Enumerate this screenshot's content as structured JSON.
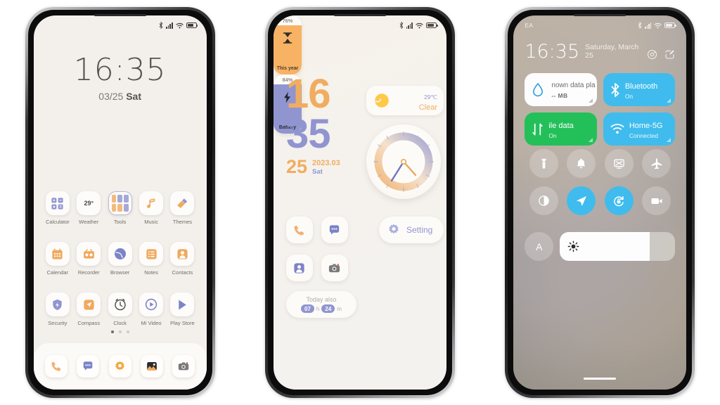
{
  "page": {
    "background": "#ffffff"
  },
  "phone1": {
    "name": "home-screen",
    "statusbar": {
      "icons": [
        "bluetooth-icon",
        "signal-icon",
        "wifi-icon",
        "battery-icon"
      ]
    },
    "clock": {
      "time": "16:35",
      "date_mmdd": "03/25",
      "weekday": "Sat"
    },
    "apps": [
      {
        "label": "Calculator",
        "icon": "calculator-icon"
      },
      {
        "label": "Weather",
        "icon": "weather-icon",
        "badge": "29°"
      },
      {
        "label": "Tools",
        "icon": "folder-icon"
      },
      {
        "label": "Music",
        "icon": "music-icon"
      },
      {
        "label": "Themes",
        "icon": "themes-icon"
      },
      {
        "label": "Calendar",
        "icon": "calendar-icon"
      },
      {
        "label": "Recorder",
        "icon": "recorder-icon"
      },
      {
        "label": "Browser",
        "icon": "browser-icon"
      },
      {
        "label": "Notes",
        "icon": "notes-icon"
      },
      {
        "label": "Contacts",
        "icon": "contacts-icon"
      },
      {
        "label": "Security",
        "icon": "security-icon"
      },
      {
        "label": "Compass",
        "icon": "compass-icon"
      },
      {
        "label": "Clock",
        "icon": "clock-icon"
      },
      {
        "label": "Mi Video",
        "icon": "mi-video-icon"
      },
      {
        "label": "Play Store",
        "icon": "play-store-icon"
      }
    ],
    "page_indicator": {
      "count": 3,
      "active": 0
    },
    "dock": [
      {
        "name": "phone-app",
        "icon": "phone-icon"
      },
      {
        "name": "messages-app",
        "icon": "message-icon"
      },
      {
        "name": "settings-app",
        "icon": "gear-icon"
      },
      {
        "name": "gallery-app",
        "icon": "gallery-icon"
      },
      {
        "name": "camera-app",
        "icon": "camera-icon"
      }
    ]
  },
  "phone2": {
    "name": "widget-home-screen",
    "clock": {
      "hour": "16",
      "minute": "35",
      "day": "25",
      "year_month": "2023.03",
      "weekday": "Sat"
    },
    "weather_widget": {
      "temperature": "29℃",
      "condition": "Clear",
      "icon": "sun-icon"
    },
    "analog_clock": {
      "icon": "analog-clock-widget"
    },
    "setting_widget": {
      "label": "Setting",
      "icon": "gear-icon"
    },
    "shortcuts": [
      {
        "name": "phone-shortcut",
        "icon": "phone-icon"
      },
      {
        "name": "messages-shortcut",
        "icon": "message-icon"
      },
      {
        "name": "contacts-shortcut",
        "icon": "contacts-icon"
      },
      {
        "name": "camera-shortcut",
        "icon": "camera-icon"
      }
    ],
    "today_widget": {
      "title": "Today also",
      "hours": "07",
      "hours_unit": "h",
      "minutes": "24",
      "minutes_unit": "m"
    },
    "year_widget": {
      "percent": "76%",
      "label": "This year",
      "icon": "hourglass-icon",
      "value": 76
    },
    "battery_widget": {
      "percent": "84%",
      "label": "Battery",
      "icon": "bolt-icon",
      "value": 84
    }
  },
  "phone3": {
    "name": "control-center",
    "statusbar": {
      "carrier": "EA",
      "icons": [
        "bluetooth-icon",
        "signal-icon",
        "wifi-icon",
        "battery-icon"
      ]
    },
    "header": {
      "time": "16:35",
      "date": "Saturday, March 25",
      "actions": [
        {
          "name": "settings-button",
          "icon": "gear-icon"
        },
        {
          "name": "edit-button",
          "icon": "edit-icon"
        }
      ]
    },
    "tiles": [
      {
        "name": "data-plan-tile",
        "title": "nown data pla",
        "subtitle": "-- MB",
        "icon": "data-drop-icon",
        "state": "off",
        "color": "#fdfdfd"
      },
      {
        "name": "bluetooth-tile",
        "title": "Bluetooth",
        "subtitle": "On",
        "icon": "bluetooth-icon",
        "state": "on",
        "color": "#3fbced"
      },
      {
        "name": "mobile-data-tile",
        "title": "ile data",
        "subtitle": "On",
        "icon": "data-arrows-icon",
        "state": "on",
        "color": "#23c05a"
      },
      {
        "name": "wifi-tile",
        "title": "Home-5G",
        "subtitle": "Connected",
        "icon": "wifi-icon",
        "state": "on",
        "color": "#3fbced"
      }
    ],
    "circle_toggles": [
      {
        "name": "flashlight-toggle",
        "icon": "flashlight-icon",
        "state": "off"
      },
      {
        "name": "ringtone-toggle",
        "icon": "bell-icon",
        "state": "off"
      },
      {
        "name": "cast-toggle",
        "icon": "cast-off-icon",
        "state": "off"
      },
      {
        "name": "airplane-mode-toggle",
        "icon": "airplane-icon",
        "state": "off"
      },
      {
        "name": "dark-mode-toggle",
        "icon": "contrast-icon",
        "state": "off"
      },
      {
        "name": "location-toggle",
        "icon": "location-icon",
        "state": "on"
      },
      {
        "name": "auto-rotate-toggle",
        "icon": "rotation-lock-icon",
        "state": "on"
      },
      {
        "name": "screen-recorder-toggle",
        "icon": "camcorder-icon",
        "state": "off"
      }
    ],
    "brightness": {
      "auto_label": "A",
      "icon": "brightness-icon",
      "value": 78
    }
  }
}
